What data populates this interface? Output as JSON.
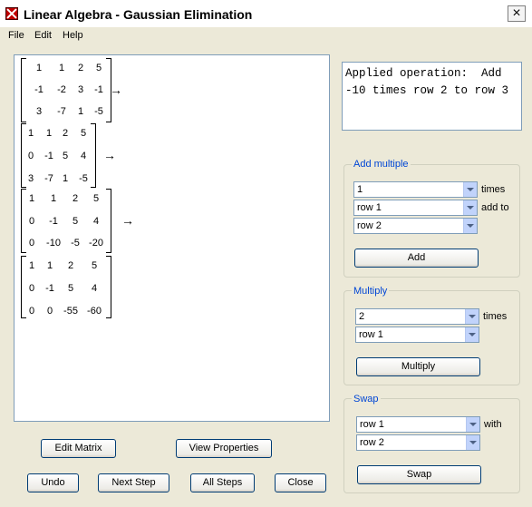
{
  "window": {
    "title": "Linear Algebra - Gaussian Elimination"
  },
  "menu": [
    "File",
    "Edit",
    "Help"
  ],
  "matrices": [
    {
      "rows": [
        [
          "1",
          "1",
          "2",
          "5"
        ],
        [
          "-1",
          "-2",
          "3",
          "-1"
        ],
        [
          "3",
          "-7",
          "1",
          "-5"
        ]
      ],
      "arrow": "→"
    },
    {
      "rows": [
        [
          "1",
          "1",
          "2",
          "5"
        ],
        [
          "0",
          "-1",
          "5",
          "4"
        ],
        [
          "3",
          "-7",
          "1",
          "-5"
        ]
      ],
      "arrow": "→"
    },
    {
      "rows": [
        [
          "1",
          "1",
          "2",
          "5"
        ],
        [
          "0",
          "-1",
          "5",
          "4"
        ],
        [
          "0",
          "-10",
          "-5",
          "-20"
        ]
      ],
      "arrow": "→"
    },
    {
      "rows": [
        [
          "1",
          "1",
          "2",
          "5"
        ],
        [
          "0",
          "-1",
          "5",
          "4"
        ],
        [
          "0",
          "0",
          "-55",
          "-60"
        ]
      ],
      "arrow": ""
    }
  ],
  "operation": {
    "line1": "Applied operation:  Add",
    "line2": "-10 times row 2 to row 3"
  },
  "add_multiple": {
    "title": "Add multiple",
    "factor": "1",
    "times_label": "times",
    "source_row": "row 1",
    "add_to_label": "add to",
    "target_row": "row 2",
    "button": "Add"
  },
  "multiply": {
    "title": "Multiply",
    "factor": "2",
    "times_label": "times",
    "row": "row 1",
    "button": "Multiply"
  },
  "swap": {
    "title": "Swap",
    "row_a": "row 1",
    "with_label": "with",
    "row_b": "row 2",
    "button": "Swap"
  },
  "buttons": {
    "edit_matrix": "Edit Matrix",
    "view_properties": "View Properties",
    "undo": "Undo",
    "next_step": "Next Step",
    "all_steps": "All Steps",
    "close": "Close"
  },
  "icons": {
    "app": "app-x-icon",
    "close": "close-icon"
  },
  "colors": {
    "background": "#ece9d8",
    "group_title": "#0046d5",
    "button_border": "#003c74"
  }
}
